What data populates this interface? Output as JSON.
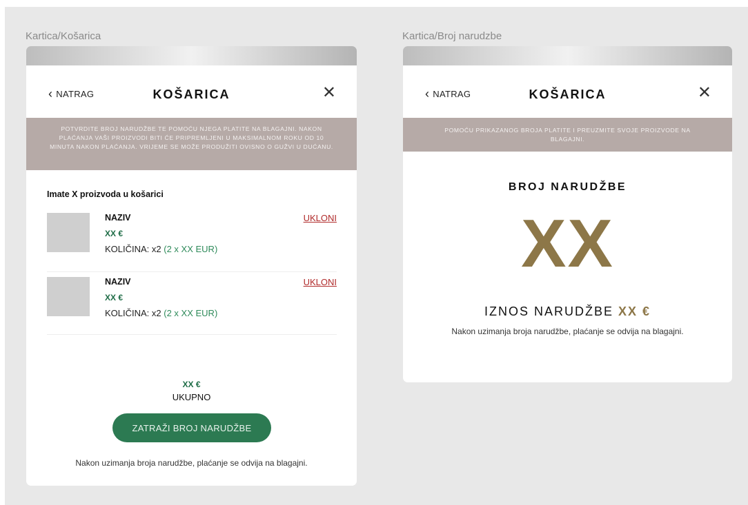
{
  "frames": {
    "left_label": "Kartica/Košarica",
    "right_label": "Kartica/Broj narudzbe"
  },
  "header": {
    "back_label": "NATRAG",
    "title": "KOŠARICA",
    "close_icon": "close-icon"
  },
  "cart": {
    "notice": "POTVRDITE BROJ NARUDŽBE TE POMOĆU NJEGA PLATITE NA BLAGAJNI. NAKON PLAĆANJA VAŠI PROIZVODI BITI ĆE PRIPREMLJENI U MAKSIMALNOM ROKU OD 10 MINUTA NAKON PLAĆANJA. VRIJEME SE MOŽE PRODUŽITI OVISNO O GUŽVI U DUĆANU.",
    "items_heading": "Imate X proizvoda u košarici",
    "items": [
      {
        "name": "NAZIV",
        "price": "XX €",
        "qty_label": "KOLIČINA: x2",
        "qty_detail": "(2 x XX EUR)",
        "remove_label": "UKLONI"
      },
      {
        "name": "NAZIV",
        "price": "XX €",
        "qty_label": "KOLIČINA: x2",
        "qty_detail": "(2 x XX EUR)",
        "remove_label": "UKLONI"
      }
    ],
    "total_price": "XX €",
    "total_label": "UKUPNO",
    "cta_label": "ZATRAŽI BROJ NARUDŽBE",
    "footnote": "Nakon uzimanja broja narudžbe, plaćanje se odvija na blagajni."
  },
  "order": {
    "notice": "POMOĆU PRIKAZANOG BROJA PLATITE I PREUZMITE SVOJE PROIZVODE NA BLAGAJNI.",
    "heading": "BROJ NARUDŽBE",
    "number": "XX",
    "amount_label": "IZNOS NARUDŽBE",
    "amount_value": "XX €",
    "footnote": "Nakon uzimanja broja narudžbe, plaćanje se odvija na blagajni."
  },
  "colors": {
    "accent_green": "#2c7a52",
    "gold": "#8d7748",
    "notice_bg": "#b6aaa7",
    "remove_red": "#b02a2a"
  }
}
